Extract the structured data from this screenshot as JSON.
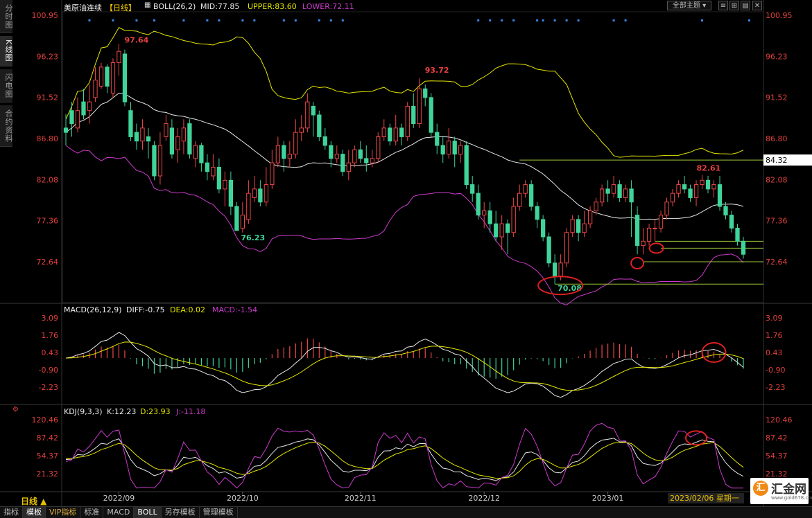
{
  "colors": {
    "up": "#f04848",
    "down": "#3fd49a",
    "mid": "#e8e8e8",
    "upper": "#e6e600",
    "lower": "#cc3ccc",
    "axis": "#e0403c",
    "hline": "#9ec93a",
    "blue": "#3a86e8",
    "grid": "#1a1a1a"
  },
  "sidebar": {
    "tabs": [
      {
        "label": "分时图"
      },
      {
        "label": "K线图",
        "active": true
      },
      {
        "label": "闪电图"
      },
      {
        "label": "合约资料"
      }
    ]
  },
  "main": {
    "symbol": "美原油连续",
    "period_tag": "【日线】",
    "boll": {
      "name": "BOLL(26,2)",
      "mid": "MID:77.85",
      "upper": "UPPER:83.60",
      "lower": "LOWER:72.11"
    },
    "theme_button": "全部主题",
    "price_ticks": [
      "100.95",
      "96.23",
      "91.52",
      "86.80",
      "82.08",
      "77.36",
      "72.64"
    ],
    "price_tag": "84.32",
    "annotations": [
      "97.64",
      "93.72",
      "76.23",
      "70.08",
      "82.61"
    ]
  },
  "macd": {
    "name": "MACD(26,12,9)",
    "diff": "DIFF:-0.75",
    "dea": "DEA:0.02",
    "macd": "MACD:-1.54",
    "ticks": [
      "3.09",
      "1.76",
      "0.43",
      "-0.90",
      "-2.23"
    ]
  },
  "kdj": {
    "name": "KDJ(9,3,3)",
    "k": "K:12.23",
    "d": "D:23.93",
    "j": "J:-11.18",
    "ticks": [
      "120.46",
      "87.42",
      "54.37",
      "21.32"
    ]
  },
  "xaxis": {
    "labels": [
      "2022/09",
      "2022/10",
      "2022/11",
      "2022/12",
      "2023/01"
    ]
  },
  "footer": {
    "period": "日线 ▲",
    "date": "2023/02/06 星期一",
    "tabs": [
      {
        "label": "指标"
      },
      {
        "label": "模板",
        "active": true
      },
      {
        "label": "VIP指标",
        "vip": true
      },
      {
        "label": "标准"
      },
      {
        "label": "MACD"
      },
      {
        "label": "BOLL",
        "active": true
      },
      {
        "label": "另存模板"
      },
      {
        "label": "管理模板"
      }
    ]
  },
  "logo": {
    "mark": "汇",
    "name": "汇金网",
    "url": "www.gold678.com"
  },
  "chart_data": {
    "type": "candlestick",
    "title": "美原油连续【日线】",
    "ylim": [
      70.08,
      100.95
    ],
    "x": [
      "2022/08/22",
      "2022/08/23",
      "2022/08/24",
      "2022/08/25",
      "2022/08/26",
      "2022/08/29",
      "2022/08/30",
      "2022/08/31",
      "2022/09/01",
      "2022/09/02",
      "2022/09/06",
      "2022/09/07",
      "2022/09/08",
      "2022/09/09",
      "2022/09/12",
      "2022/09/13",
      "2022/09/14",
      "2022/09/15",
      "2022/09/16",
      "2022/09/19",
      "2022/09/20",
      "2022/09/21",
      "2022/09/22",
      "2022/09/23",
      "2022/09/26",
      "2022/09/27",
      "2022/09/28",
      "2022/09/29",
      "2022/09/30",
      "2022/10/03",
      "2022/10/04",
      "2022/10/05",
      "2022/10/06",
      "2022/10/07",
      "2022/10/10",
      "2022/10/11",
      "2022/10/12",
      "2022/10/13",
      "2022/10/14",
      "2022/10/17",
      "2022/10/18",
      "2022/10/19",
      "2022/10/20",
      "2022/10/21",
      "2022/10/24",
      "2022/10/25",
      "2022/10/26",
      "2022/10/27",
      "2022/10/28",
      "2022/10/31",
      "2022/11/01",
      "2022/11/02",
      "2022/11/03",
      "2022/11/04",
      "2022/11/07",
      "2022/11/08",
      "2022/11/09",
      "2022/11/10",
      "2022/11/11",
      "2022/11/14",
      "2022/11/15",
      "2022/11/16",
      "2022/11/17",
      "2022/11/18",
      "2022/11/21",
      "2022/11/22",
      "2022/11/23",
      "2022/11/25",
      "2022/11/28",
      "2022/11/29",
      "2022/11/30",
      "2022/12/01",
      "2022/12/02",
      "2022/12/05",
      "2022/12/06",
      "2022/12/07",
      "2022/12/08",
      "2022/12/09",
      "2022/12/12",
      "2022/12/13",
      "2022/12/14",
      "2022/12/15",
      "2022/12/16",
      "2022/12/19",
      "2022/12/20",
      "2022/12/21",
      "2022/12/22",
      "2022/12/23",
      "2022/12/27",
      "2022/12/28",
      "2022/12/29",
      "2022/12/30",
      "2023/01/03",
      "2023/01/04",
      "2023/01/05",
      "2023/01/06",
      "2023/01/09",
      "2023/01/10",
      "2023/01/11",
      "2023/01/12",
      "2023/01/13",
      "2023/01/17",
      "2023/01/18",
      "2023/01/19",
      "2023/01/20",
      "2023/01/23",
      "2023/01/24",
      "2023/01/25",
      "2023/01/26",
      "2023/01/27",
      "2023/01/30",
      "2023/01/31",
      "2023/02/01",
      "2023/02/02",
      "2023/02/03",
      "2023/02/06"
    ],
    "ohlc": [
      [
        88.0,
        87.5,
        89.6,
        86.0
      ],
      [
        90.0,
        88.5,
        91.0,
        87.0
      ],
      [
        88.0,
        90.0,
        91.5,
        87.5
      ],
      [
        91.0,
        89.5,
        92.5,
        89.0
      ],
      [
        90.0,
        91.0,
        93.0,
        88.5
      ],
      [
        91.5,
        93.5,
        95.0,
        91.0
      ],
      [
        92.8,
        95.0,
        95.5,
        92.5
      ],
      [
        95.0,
        92.8,
        95.3,
        92.0
      ],
      [
        92.0,
        95.5,
        96.0,
        91.5
      ],
      [
        95.5,
        96.8,
        97.64,
        94.0
      ],
      [
        96.5,
        91.0,
        97.0,
        90.5
      ],
      [
        90.0,
        87.0,
        91.0,
        86.5
      ],
      [
        87.5,
        86.5,
        88.5,
        85.5
      ],
      [
        86.5,
        88.0,
        89.0,
        85.5
      ],
      [
        87.0,
        86.5,
        88.0,
        84.5
      ],
      [
        86.0,
        82.5,
        86.5,
        82.0
      ],
      [
        82.5,
        86.0,
        87.5,
        81.5
      ],
      [
        87.0,
        88.5,
        89.5,
        86.5
      ],
      [
        88.0,
        85.0,
        89.0,
        84.5
      ],
      [
        85.5,
        87.0,
        88.0,
        84.0
      ],
      [
        86.5,
        88.0,
        89.0,
        85.0
      ],
      [
        88.5,
        85.0,
        89.0,
        84.5
      ],
      [
        84.5,
        86.0,
        86.5,
        83.5
      ],
      [
        86.0,
        84.0,
        86.3,
        83.0
      ],
      [
        84.0,
        83.0,
        85.0,
        82.0
      ],
      [
        82.5,
        83.5,
        85.0,
        82.0
      ],
      [
        83.5,
        81.0,
        84.5,
        80.5
      ],
      [
        81.0,
        82.0,
        83.0,
        79.0
      ],
      [
        82.0,
        79.0,
        83.0,
        78.0
      ],
      [
        79.0,
        76.23,
        79.5,
        76.23
      ],
      [
        76.5,
        78.0,
        79.5,
        76.0
      ],
      [
        77.5,
        80.5,
        82.0,
        77.0
      ],
      [
        80.0,
        81.0,
        82.5,
        79.5
      ],
      [
        81.0,
        79.5,
        82.0,
        79.0
      ],
      [
        79.5,
        81.5,
        83.5,
        79.0
      ],
      [
        81.5,
        84.0,
        85.5,
        81.0
      ],
      [
        84.0,
        86.0,
        87.0,
        83.5
      ],
      [
        86.0,
        84.5,
        86.5,
        83.0
      ],
      [
        84.5,
        85.0,
        86.5,
        83.5
      ],
      [
        85.0,
        87.5,
        89.0,
        84.5
      ],
      [
        87.5,
        88.0,
        89.5,
        86.5
      ],
      [
        88.0,
        91.0,
        92.0,
        87.5
      ],
      [
        90.5,
        89.5,
        91.0,
        87.0
      ],
      [
        89.5,
        87.0,
        90.0,
        86.5
      ],
      [
        87.0,
        86.0,
        88.0,
        85.5
      ],
      [
        86.0,
        84.5,
        86.5,
        83.5
      ],
      [
        84.5,
        85.0,
        86.0,
        84.0
      ],
      [
        85.0,
        83.0,
        85.5,
        82.5
      ],
      [
        83.0,
        84.0,
        85.5,
        82.0
      ],
      [
        84.0,
        85.5,
        86.0,
        83.5
      ],
      [
        85.5,
        84.5,
        86.5,
        84.0
      ],
      [
        84.5,
        84.0,
        86.0,
        83.0
      ],
      [
        84.0,
        84.5,
        85.5,
        83.5
      ],
      [
        84.5,
        87.0,
        87.5,
        84.0
      ],
      [
        87.0,
        88.0,
        89.0,
        86.5
      ],
      [
        88.0,
        86.5,
        88.5,
        86.0
      ],
      [
        86.5,
        88.0,
        89.5,
        86.0
      ],
      [
        88.0,
        87.0,
        88.5,
        86.0
      ],
      [
        87.0,
        90.5,
        91.0,
        86.5
      ],
      [
        90.5,
        88.5,
        92.0,
        88.0
      ],
      [
        88.5,
        92.5,
        93.72,
        88.0
      ],
      [
        92.5,
        91.5,
        93.0,
        90.5
      ],
      [
        91.5,
        87.5,
        92.0,
        87.0
      ],
      [
        87.5,
        86.0,
        88.5,
        85.0
      ],
      [
        86.0,
        85.0,
        87.0,
        84.0
      ],
      [
        85.0,
        86.5,
        88.0,
        84.5
      ],
      [
        86.5,
        85.0,
        87.0,
        83.5
      ],
      [
        85.0,
        86.0,
        86.5,
        84.0
      ],
      [
        86.0,
        81.5,
        86.5,
        81.0
      ],
      [
        81.5,
        80.5,
        82.5,
        79.5
      ],
      [
        80.5,
        78.0,
        81.5,
        77.5
      ],
      [
        78.0,
        78.5,
        79.5,
        76.5
      ],
      [
        78.5,
        77.0,
        79.5,
        76.0
      ],
      [
        77.0,
        75.5,
        78.5,
        75.0
      ],
      [
        75.5,
        77.0,
        78.0,
        74.0
      ],
      [
        77.0,
        76.0,
        77.5,
        73.5
      ],
      [
        76.0,
        79.0,
        80.0,
        75.5
      ],
      [
        79.0,
        80.5,
        81.5,
        78.5
      ],
      [
        80.5,
        81.5,
        82.0,
        80.0
      ],
      [
        81.5,
        79.0,
        82.0,
        78.5
      ],
      [
        79.0,
        77.5,
        79.5,
        76.5
      ],
      [
        77.5,
        75.5,
        78.0,
        75.0
      ],
      [
        75.5,
        72.5,
        76.0,
        72.0
      ],
      [
        72.5,
        71.0,
        73.5,
        70.08
      ],
      [
        71.0,
        72.5,
        73.5,
        70.5
      ],
      [
        72.5,
        76.0,
        76.5,
        72.0
      ],
      [
        76.0,
        77.5,
        78.0,
        75.5
      ],
      [
        77.5,
        76.0,
        78.0,
        75.0
      ],
      [
        76.0,
        77.0,
        78.5,
        75.5
      ],
      [
        77.0,
        78.5,
        79.0,
        76.5
      ],
      [
        78.5,
        79.5,
        80.0,
        78.0
      ],
      [
        79.5,
        81.0,
        81.5,
        79.0
      ],
      [
        81.0,
        80.5,
        82.0,
        79.5
      ],
      [
        80.5,
        81.5,
        82.5,
        80.0
      ],
      [
        81.5,
        80.0,
        82.0,
        79.5
      ],
      [
        80.0,
        81.0,
        81.5,
        79.5
      ],
      [
        81.0,
        79.5,
        82.0,
        75.5
      ],
      [
        78.0,
        74.5,
        79.0,
        73.5
      ],
      [
        74.5,
        75.0,
        76.5,
        73.5
      ],
      [
        75.0,
        76.5,
        77.0,
        74.5
      ],
      [
        76.5,
        76.5,
        77.5,
        75.0
      ],
      [
        76.5,
        78.0,
        78.5,
        76.0
      ],
      [
        78.0,
        79.5,
        80.0,
        77.5
      ],
      [
        79.5,
        80.5,
        81.0,
        79.0
      ],
      [
        80.5,
        81.5,
        82.0,
        80.0
      ],
      [
        81.5,
        81.0,
        82.5,
        80.5
      ],
      [
        81.0,
        80.0,
        81.5,
        79.5
      ],
      [
        80.0,
        81.5,
        82.0,
        79.0
      ],
      [
        81.5,
        82.0,
        82.61,
        81.0
      ],
      [
        82.0,
        81.0,
        82.5,
        80.5
      ],
      [
        81.0,
        81.5,
        82.0,
        80.0
      ],
      [
        81.5,
        79.0,
        82.5,
        78.5
      ],
      [
        79.0,
        78.0,
        79.5,
        77.5
      ],
      [
        78.0,
        76.5,
        78.5,
        76.0
      ],
      [
        76.5,
        75.0,
        77.0,
        74.5
      ],
      [
        75.0,
        73.5,
        75.5,
        73.0
      ]
    ],
    "boll": {
      "mid": "MID:77.85",
      "upper": "UPPER:83.60",
      "lower": "LOWER:72.11"
    },
    "y_ticks": [
      100.95,
      96.23,
      91.52,
      86.8,
      82.08,
      77.36,
      72.64
    ]
  }
}
